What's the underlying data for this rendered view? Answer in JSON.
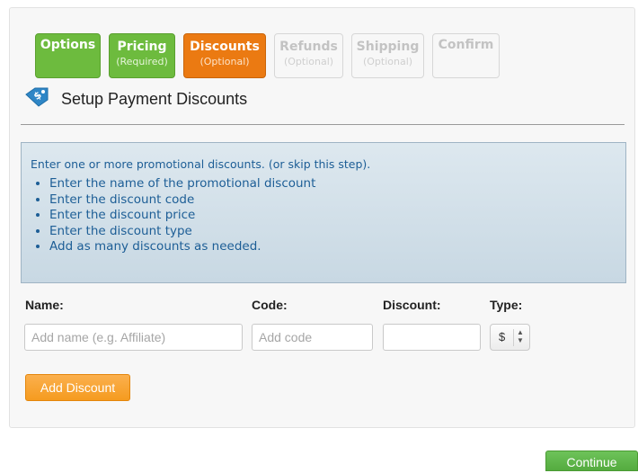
{
  "wizard": {
    "steps": [
      {
        "title": "Options",
        "subtitle": "",
        "state": "done"
      },
      {
        "title": "Pricing",
        "subtitle": "(Required)",
        "state": "done"
      },
      {
        "title": "Discounts",
        "subtitle": "(Optional)",
        "state": "active"
      },
      {
        "title": "Refunds",
        "subtitle": "(Optional)",
        "state": "todo"
      },
      {
        "title": "Shipping",
        "subtitle": "(Optional)",
        "state": "todo"
      },
      {
        "title": "Confirm",
        "subtitle": "",
        "state": "todo"
      }
    ]
  },
  "section": {
    "icon": "discount-tag-icon",
    "title": "Setup Payment Discounts"
  },
  "info": {
    "intro": "Enter one or more promotional discounts. (or skip this step).",
    "bullets": [
      "Enter the name of the promotional discount",
      "Enter the discount code",
      "Enter the discount price",
      "Enter the discount type",
      "Add as many discounts as needed."
    ]
  },
  "form": {
    "name_label": "Name:",
    "name_placeholder": "Add name (e.g. Affiliate)",
    "name_value": "",
    "code_label": "Code:",
    "code_placeholder": "Add code",
    "code_value": "",
    "discount_label": "Discount:",
    "discount_placeholder": "",
    "discount_value": "",
    "type_label": "Type:",
    "type_value": "$"
  },
  "buttons": {
    "add_discount": "Add Discount",
    "continue": "Continue"
  },
  "colors": {
    "step_done": "#6dbb3e",
    "step_active": "#eb7a12",
    "info_text": "#1d5e96",
    "add_button": "#f7a330",
    "continue_button": "#5cb247"
  }
}
